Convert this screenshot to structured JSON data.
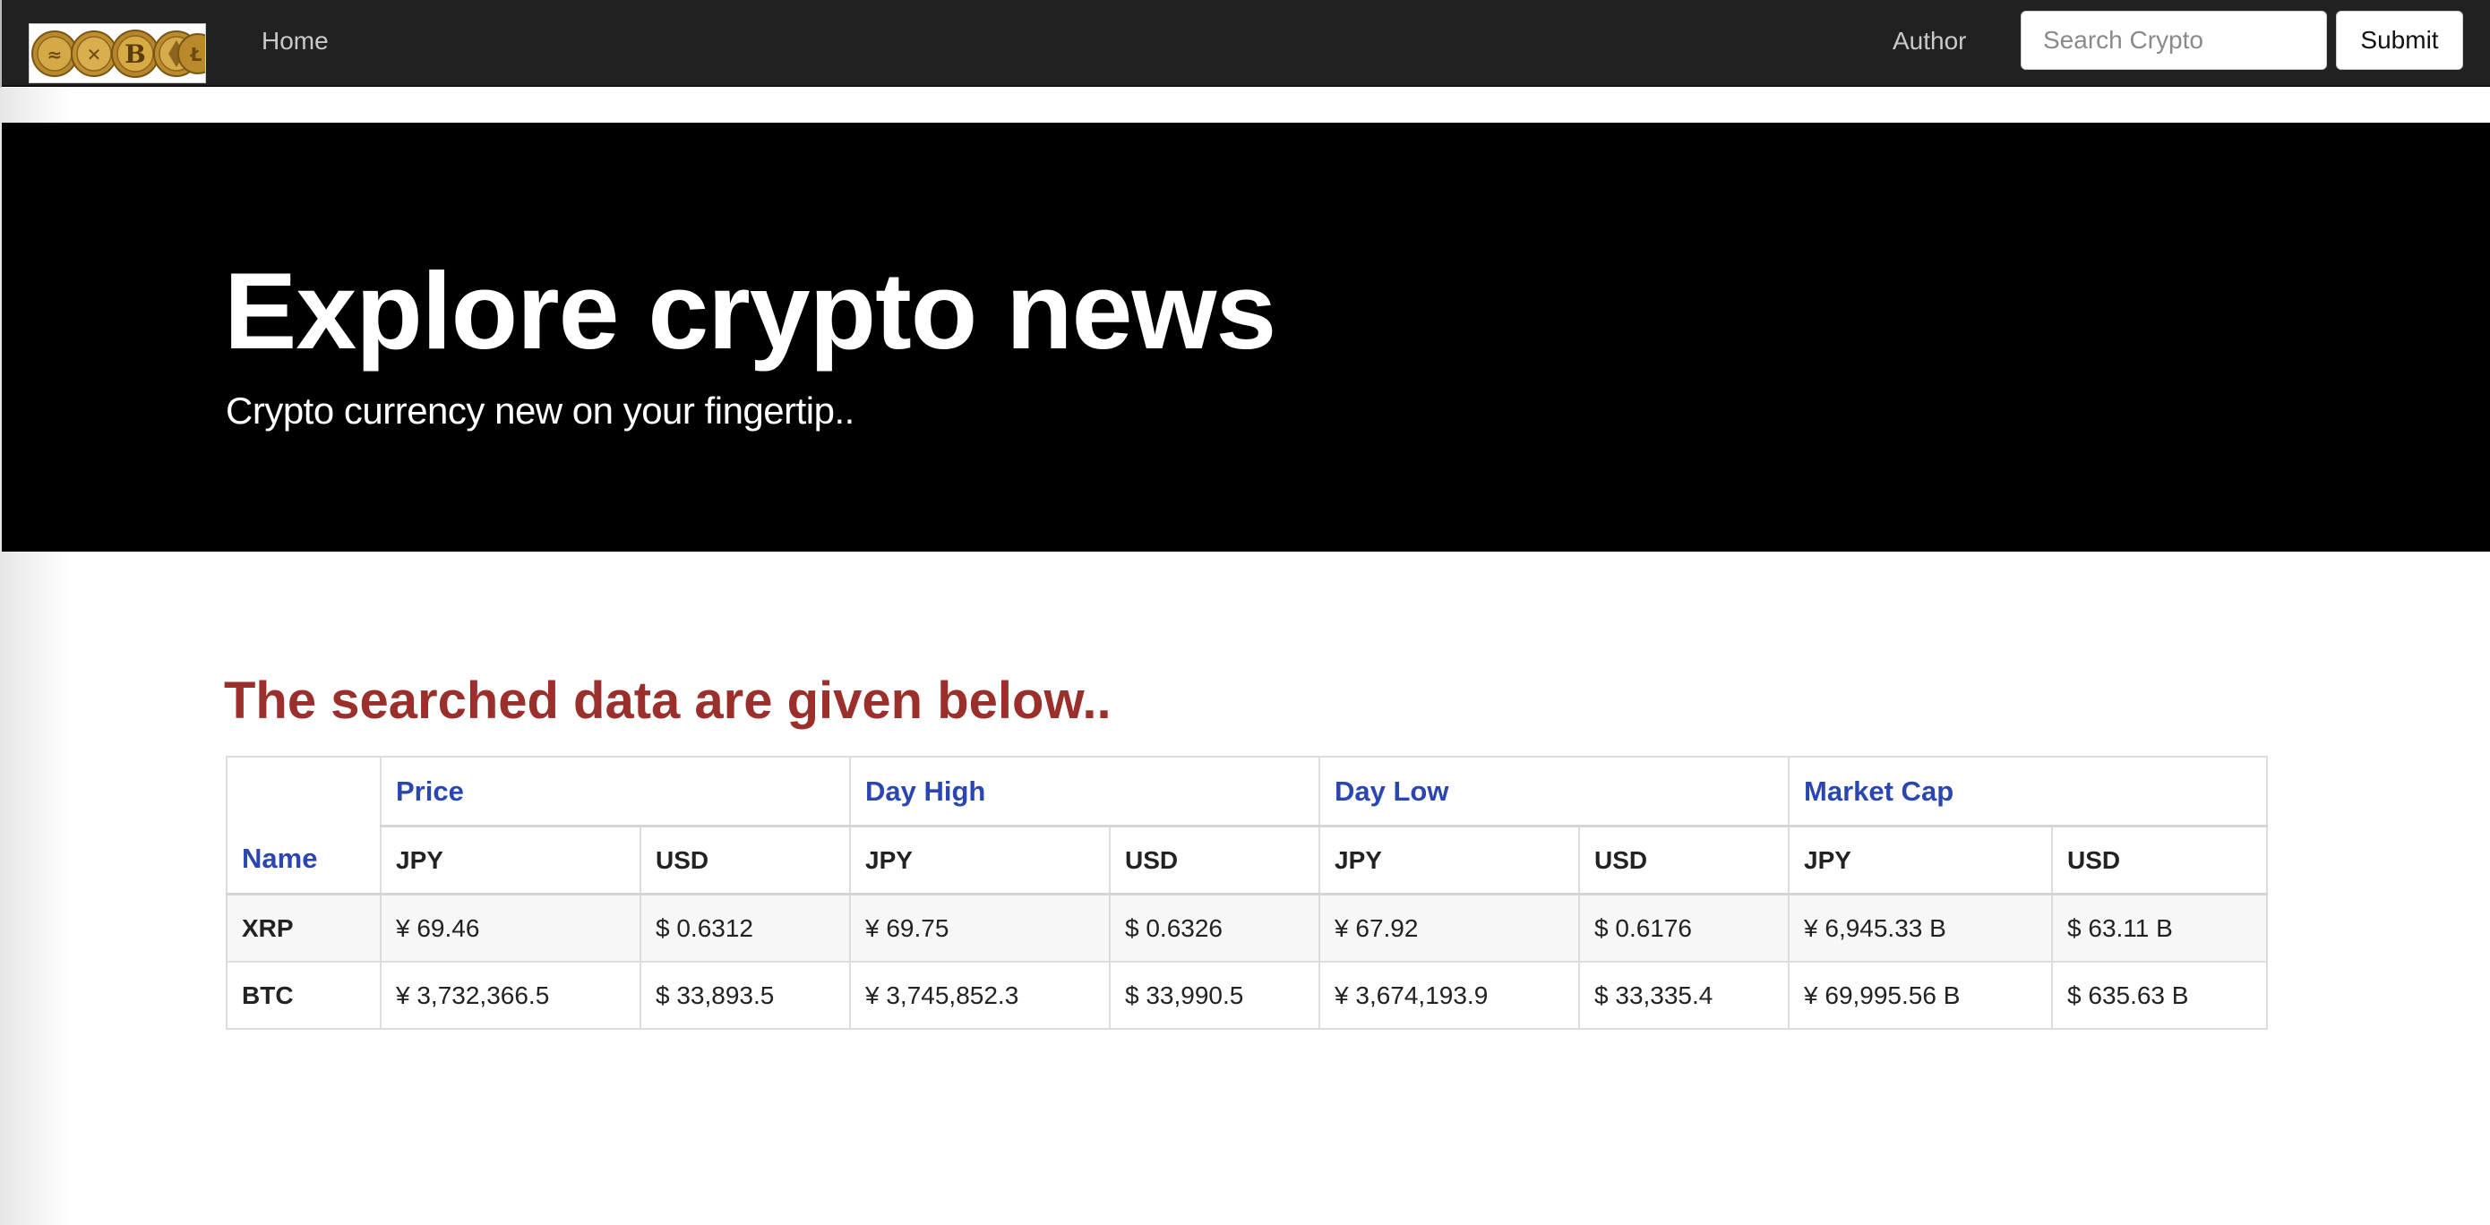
{
  "navbar": {
    "logo_alt": "crypto coins logo",
    "home_label": "Home",
    "author_label": "Author",
    "search_placeholder": "Search Crypto",
    "search_value": "",
    "submit_label": "Submit",
    "background": "#212121"
  },
  "hero": {
    "title": "Explore crypto news",
    "subtitle": "Crypto currency new on your fingertip..",
    "background": "#000000"
  },
  "results": {
    "heading": "The searched data are given below..",
    "heading_color": "#9b2f2b",
    "header_color": "#2a46b3",
    "name_header": "Name",
    "groups": [
      "Price",
      "Day High",
      "Day Low",
      "Market Cap"
    ],
    "currencies": [
      "JPY",
      "USD",
      "JPY",
      "USD",
      "JPY",
      "USD",
      "JPY",
      "USD"
    ],
    "rows": [
      {
        "name": "XRP",
        "cells": [
          "¥ 69.46",
          "$ 0.6312",
          "¥ 69.75",
          "$ 0.6326",
          "¥ 67.92",
          "$ 0.6176",
          "¥ 6,945.33 B",
          "$ 63.11 B"
        ]
      },
      {
        "name": "BTC",
        "cells": [
          "¥ 3,732,366.5",
          "$ 33,893.5",
          "¥ 3,745,852.3",
          "$ 33,990.5",
          "¥ 3,674,193.9",
          "$ 33,335.4",
          "¥ 69,995.56 B",
          "$ 635.63 B"
        ]
      }
    ]
  }
}
